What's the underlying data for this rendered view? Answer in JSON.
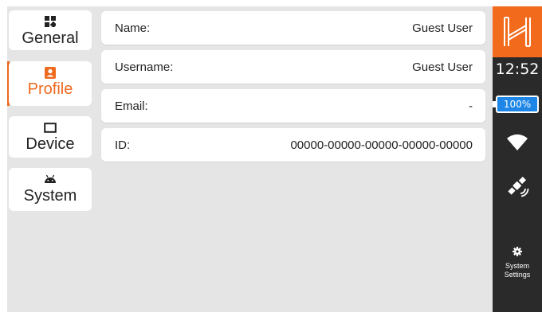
{
  "nav": {
    "items": [
      {
        "label": "General",
        "icon": "grid-icon"
      },
      {
        "label": "Profile",
        "icon": "person-badge-icon",
        "active": true
      },
      {
        "label": "Device",
        "icon": "screen-icon"
      },
      {
        "label": "System",
        "icon": "android-icon"
      }
    ]
  },
  "profile": {
    "rows": [
      {
        "label": "Name:",
        "value": "Guest User"
      },
      {
        "label": "Username:",
        "value": "Guest User"
      },
      {
        "label": "Email:",
        "value": "-"
      },
      {
        "label": "ID:",
        "value": "00000-00000-00000-00000-00000"
      }
    ]
  },
  "status": {
    "time": "12:52",
    "battery": "100%",
    "settings_label_line1": "System",
    "settings_label_line2": "Settings"
  },
  "colors": {
    "accent": "#ee6a1f",
    "battery_fill": "#1e86e6",
    "rail": "#2a2a2a"
  }
}
